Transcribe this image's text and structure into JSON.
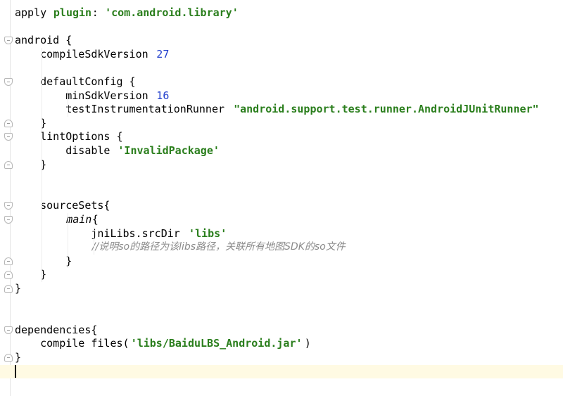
{
  "editor": {
    "lines": [
      [
        "apply ",
        {
          "t": "plugin",
          "c": "kw"
        },
        ": ",
        {
          "t": "'com.android.library'",
          "c": "str"
        }
      ],
      [],
      [
        "android {"
      ],
      [
        "    compileSdkVersion ",
        {
          "t": "27",
          "c": "num"
        }
      ],
      [],
      [
        "    defaultConfig {"
      ],
      [
        "        minSdkVersion ",
        {
          "t": "16",
          "c": "num"
        }
      ],
      [
        "        testInstrumentationRunner ",
        {
          "t": "\"android.support.test.runner.AndroidJUnitRunner\"",
          "c": "str"
        }
      ],
      [
        "    }"
      ],
      [
        "    lintOptions {"
      ],
      [
        "        disable ",
        {
          "t": "'InvalidPackage'",
          "c": "str"
        }
      ],
      [
        "    }"
      ],
      [],
      [],
      [
        "    sourceSets{"
      ],
      [
        "        ",
        {
          "t": "main",
          "c": "it"
        },
        "{"
      ],
      [
        "            jniLibs.srcDir ",
        {
          "t": "'libs'",
          "c": "str"
        }
      ],
      [
        "            ",
        {
          "t": "//说明so的路径为该libs路径，关联所有地图SDK的so文件",
          "c": "cm"
        }
      ],
      [
        "        }"
      ],
      [
        "    }"
      ],
      [
        "}"
      ],
      [],
      [],
      [
        "dependencies{"
      ],
      [
        "    compile files(",
        {
          "t": "'libs/BaiduLBS_Android.jar'",
          "c": "str"
        },
        ")"
      ],
      [
        "}"
      ],
      []
    ],
    "current_line": 26
  }
}
